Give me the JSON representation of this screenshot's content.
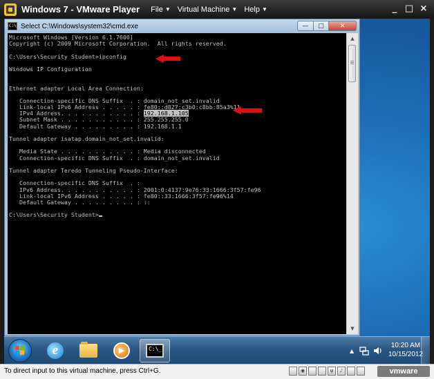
{
  "vm_window": {
    "title": "Windows 7 - VMware Player",
    "menu": [
      {
        "label": "File"
      },
      {
        "label": "Virtual Machine"
      },
      {
        "label": "Help"
      }
    ],
    "controls": {
      "minimize": "_",
      "maximize": "□",
      "close": "×"
    }
  },
  "cmd_window": {
    "title": "Select C:\\Windows\\system32\\cmd.exe",
    "controls": {
      "minimize": "—",
      "maximize": "□",
      "close": "✕"
    }
  },
  "console": {
    "lines": [
      "Microsoft Windows [Version 6.1.7600]",
      "Copyright (c) 2009 Microsoft Corporation.  All rights reserved.",
      "",
      "C:\\Users\\Security Student>ipconfig",
      "",
      "Windows IP Configuration",
      "",
      "",
      "Ethernet adapter Local Area Connection:",
      "",
      "   Connection-specific DNS Suffix  . : domain_not_set.invalid",
      "   Link-local IPv6 Address . . . . . : fe80::d827:c3b0:c8bb:85a3%11",
      "   IPv4 Address. . . . . . . . . . . : ",
      "   Subnet Mask . . . . . . . . . . . : 255.255.255.0",
      "   Default Gateway . . . . . . . . . : 192.168.1.1",
      "",
      "Tunnel adapter isatap.domain_not_set.invalid:",
      "",
      "   Media State . . . . . . . . . . . : Media disconnected",
      "   Connection-specific DNS Suffix  . : domain_not_set.invalid",
      "",
      "Tunnel adapter Teredo Tunneling Pseudo-Interface:",
      "",
      "   Connection-specific DNS Suffix  . :",
      "   IPv6 Address. . . . . . . . . . . : 2001:0:4137:9e76:33:1666:3f57:fe96",
      "   Link-local IPv6 Address . . . . . : fe80::33:1666:3f57:fe96%14",
      "   Default Gateway . . . . . . . . . : ::",
      "",
      "C:\\Users\\Security Student>"
    ],
    "highlighted_ipv4": "192.168.1.105"
  },
  "taskbar": {
    "icons": [
      {
        "name": "start-orb"
      },
      {
        "name": "internet-explorer-icon",
        "glyph": "e"
      },
      {
        "name": "windows-explorer-icon"
      },
      {
        "name": "media-player-icon",
        "glyph": "▶"
      },
      {
        "name": "command-prompt-icon",
        "glyph": "C:\\_"
      }
    ],
    "tray_arrow": "▲",
    "clock_time": "10:20 AM",
    "clock_date": "10/15/2012"
  },
  "status_bar": {
    "text": "To direct input to this virtual machine, press Ctrl+G.",
    "logo": "vmware"
  },
  "colors": {
    "annotation_arrow": "#e01010",
    "console_text": "#c0c0c0",
    "console_bg": "#000000"
  }
}
